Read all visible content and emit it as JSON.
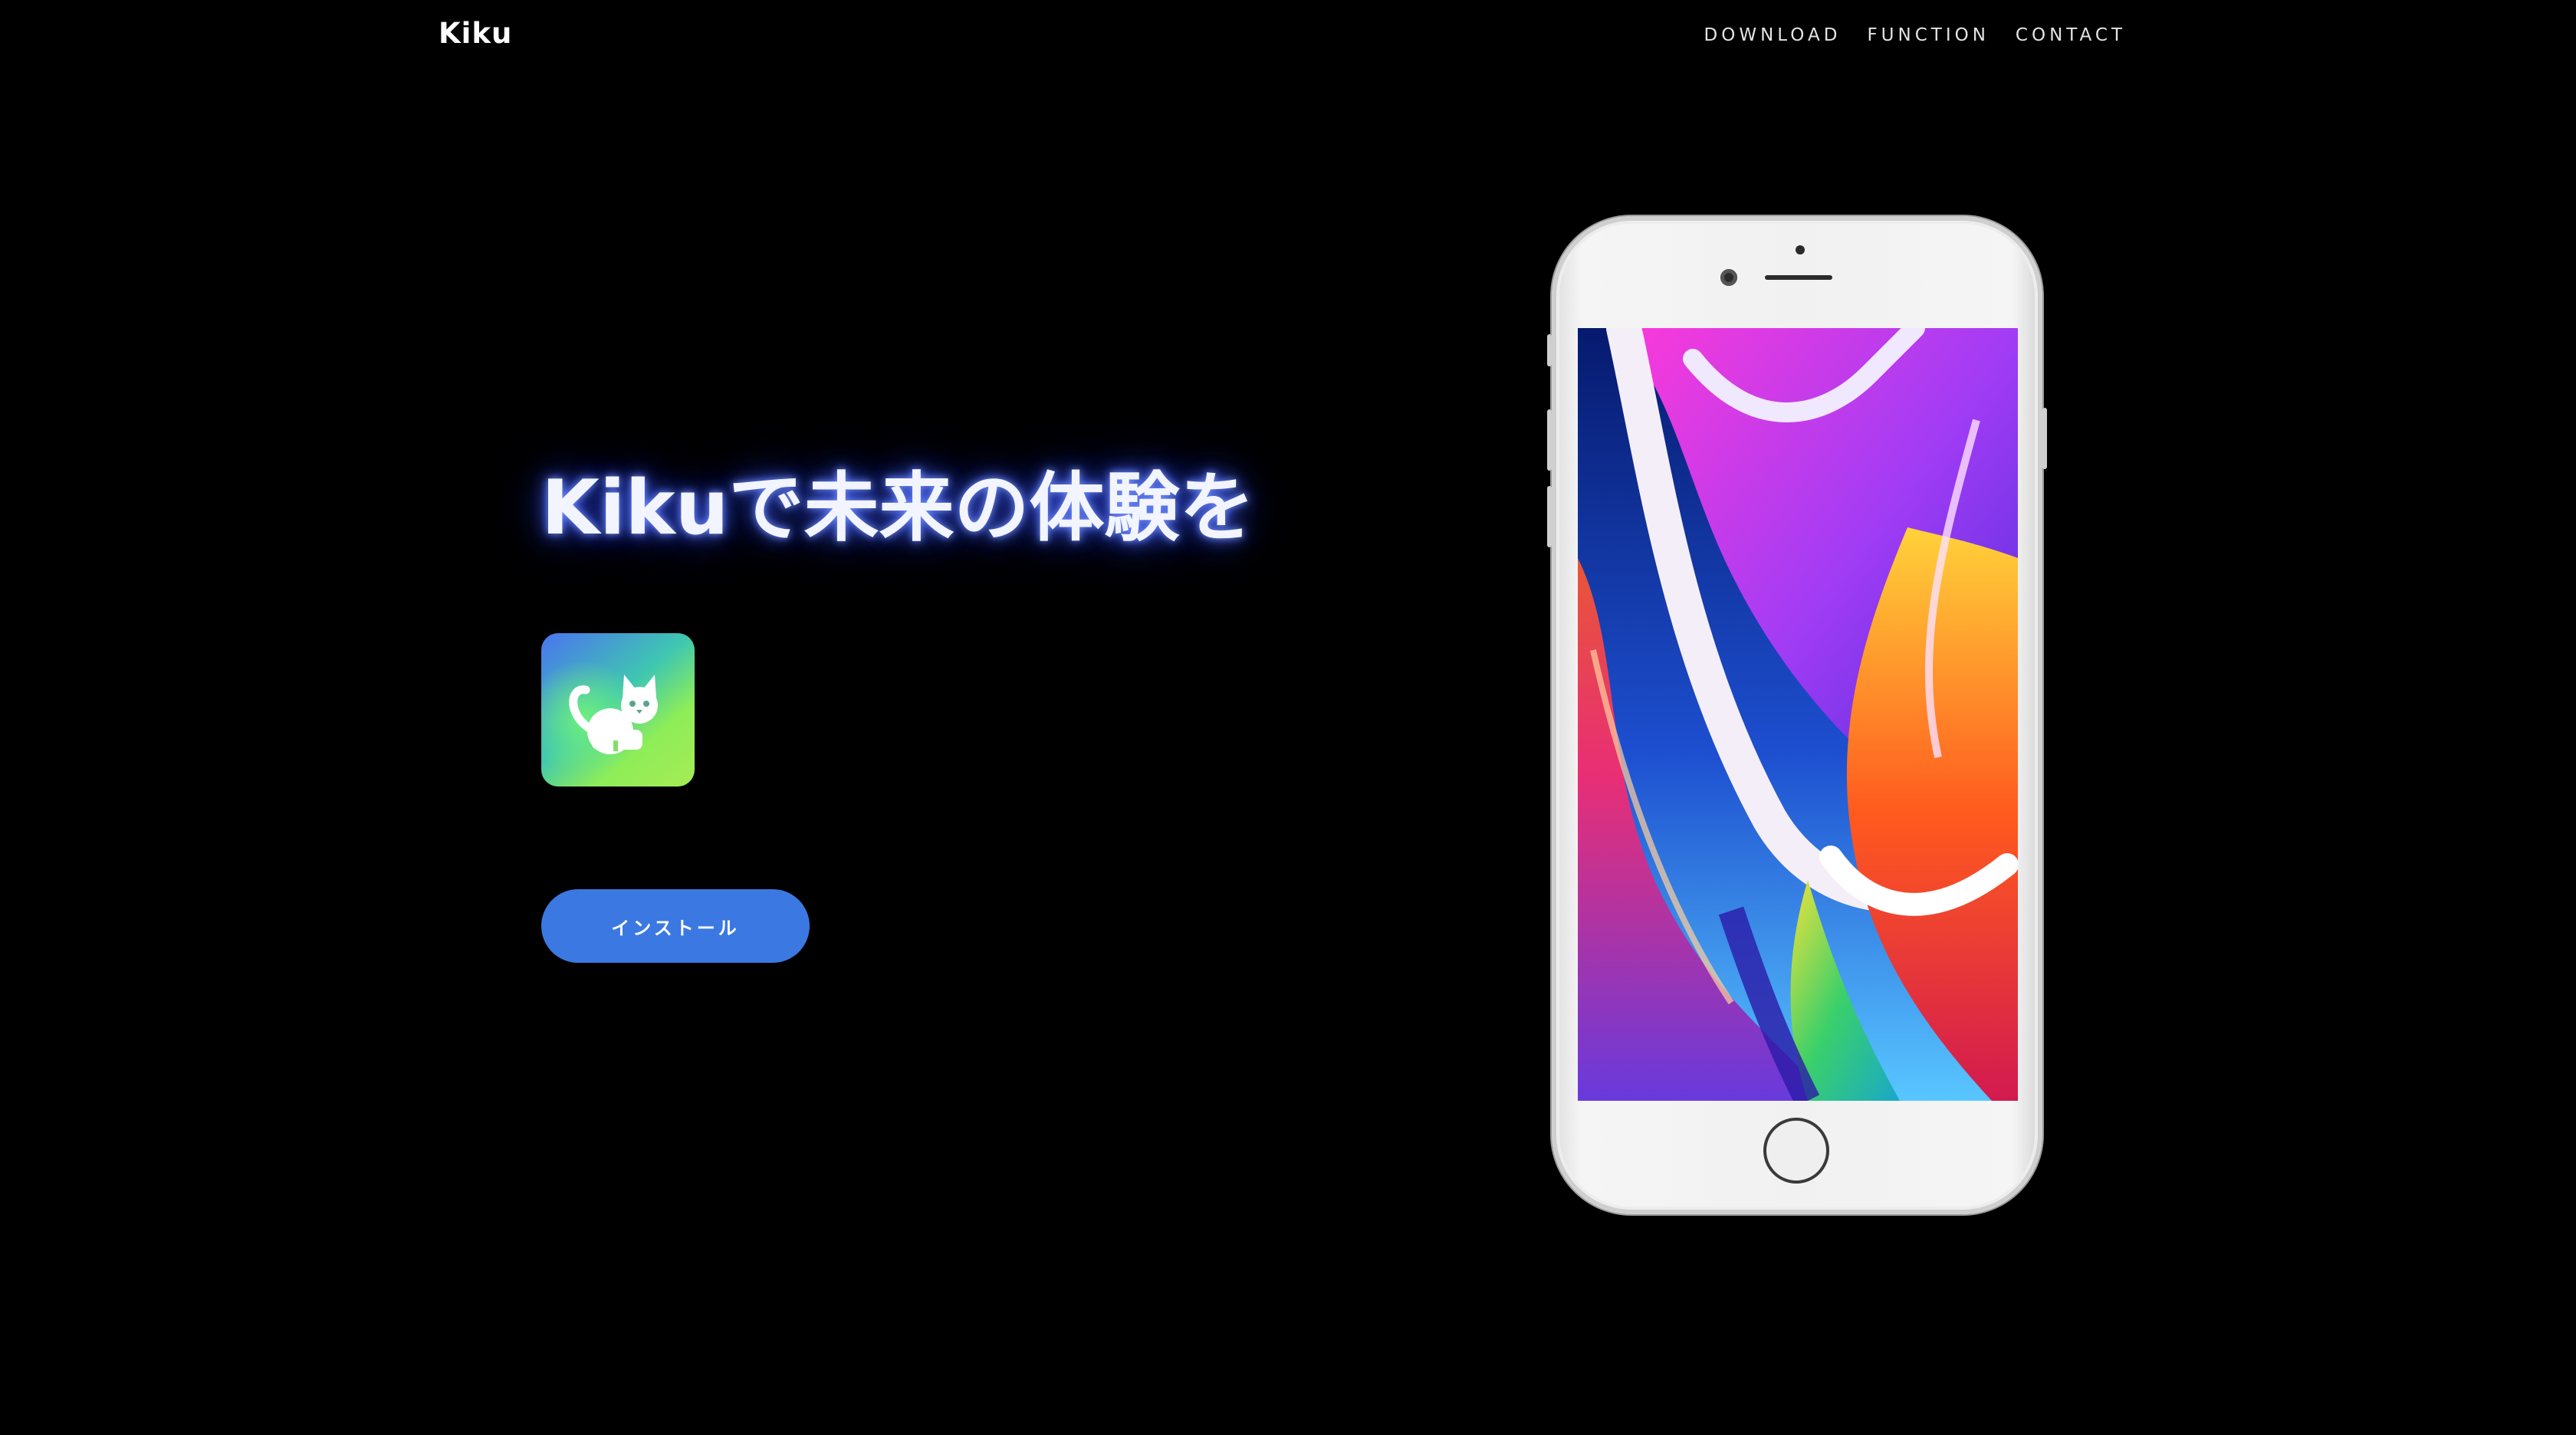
{
  "header": {
    "brand": "Kiku",
    "nav": [
      "DOWNLOAD",
      "FUNCTION",
      "CONTACT"
    ]
  },
  "hero": {
    "title": "Kikuで未来の体験を",
    "install_label": "インストール"
  },
  "colors": {
    "background": "#000000",
    "button": "#3b78e2",
    "title_glow": "#4b6bff",
    "icon_gradient": [
      "#4a74f0",
      "#3fc7b0",
      "#8ded58"
    ]
  },
  "icons": {
    "app_icon": "cat-icon"
  }
}
